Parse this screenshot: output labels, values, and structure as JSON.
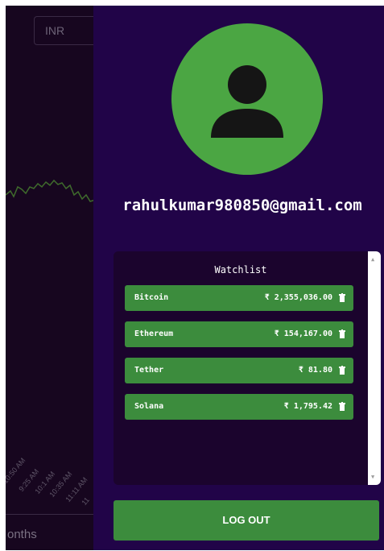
{
  "background": {
    "currency_select": "INR",
    "time_labels": [
      "10:50 AM",
      "9:25 AM",
      "10:1 AM",
      "10:35 AM",
      "11:11 AM",
      "11"
    ],
    "months_label": "onths"
  },
  "sidebar": {
    "email": "rahulkumar980850@gmail.com",
    "watchlist": {
      "title": "Watchlist",
      "items": [
        {
          "name": "Bitcoin",
          "price": "₹ 2,355,036.00"
        },
        {
          "name": "Ethereum",
          "price": "₹ 154,167.00"
        },
        {
          "name": "Tether",
          "price": "₹ 81.80"
        },
        {
          "name": "Solana",
          "price": "₹ 1,795.42"
        }
      ]
    },
    "logout_label": "LOG OUT"
  },
  "colors": {
    "sidebar_bg": "#210448",
    "accent_green": "#3c8c3d",
    "avatar_green": "#4ba643"
  }
}
